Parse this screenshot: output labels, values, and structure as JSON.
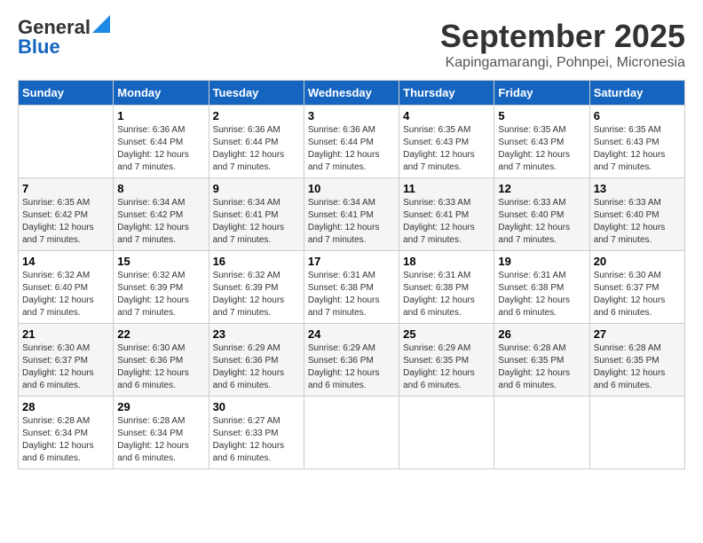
{
  "logo": {
    "general": "General",
    "blue": "Blue"
  },
  "title": "September 2025",
  "subtitle": "Kapingamarangi, Pohnpei, Micronesia",
  "days_of_week": [
    "Sunday",
    "Monday",
    "Tuesday",
    "Wednesday",
    "Thursday",
    "Friday",
    "Saturday"
  ],
  "weeks": [
    [
      {
        "day": "",
        "info": ""
      },
      {
        "day": "1",
        "info": "Sunrise: 6:36 AM\nSunset: 6:44 PM\nDaylight: 12 hours\nand 7 minutes."
      },
      {
        "day": "2",
        "info": "Sunrise: 6:36 AM\nSunset: 6:44 PM\nDaylight: 12 hours\nand 7 minutes."
      },
      {
        "day": "3",
        "info": "Sunrise: 6:36 AM\nSunset: 6:44 PM\nDaylight: 12 hours\nand 7 minutes."
      },
      {
        "day": "4",
        "info": "Sunrise: 6:35 AM\nSunset: 6:43 PM\nDaylight: 12 hours\nand 7 minutes."
      },
      {
        "day": "5",
        "info": "Sunrise: 6:35 AM\nSunset: 6:43 PM\nDaylight: 12 hours\nand 7 minutes."
      },
      {
        "day": "6",
        "info": "Sunrise: 6:35 AM\nSunset: 6:43 PM\nDaylight: 12 hours\nand 7 minutes."
      }
    ],
    [
      {
        "day": "7",
        "info": "Sunrise: 6:35 AM\nSunset: 6:42 PM\nDaylight: 12 hours\nand 7 minutes."
      },
      {
        "day": "8",
        "info": "Sunrise: 6:34 AM\nSunset: 6:42 PM\nDaylight: 12 hours\nand 7 minutes."
      },
      {
        "day": "9",
        "info": "Sunrise: 6:34 AM\nSunset: 6:41 PM\nDaylight: 12 hours\nand 7 minutes."
      },
      {
        "day": "10",
        "info": "Sunrise: 6:34 AM\nSunset: 6:41 PM\nDaylight: 12 hours\nand 7 minutes."
      },
      {
        "day": "11",
        "info": "Sunrise: 6:33 AM\nSunset: 6:41 PM\nDaylight: 12 hours\nand 7 minutes."
      },
      {
        "day": "12",
        "info": "Sunrise: 6:33 AM\nSunset: 6:40 PM\nDaylight: 12 hours\nand 7 minutes."
      },
      {
        "day": "13",
        "info": "Sunrise: 6:33 AM\nSunset: 6:40 PM\nDaylight: 12 hours\nand 7 minutes."
      }
    ],
    [
      {
        "day": "14",
        "info": "Sunrise: 6:32 AM\nSunset: 6:40 PM\nDaylight: 12 hours\nand 7 minutes."
      },
      {
        "day": "15",
        "info": "Sunrise: 6:32 AM\nSunset: 6:39 PM\nDaylight: 12 hours\nand 7 minutes."
      },
      {
        "day": "16",
        "info": "Sunrise: 6:32 AM\nSunset: 6:39 PM\nDaylight: 12 hours\nand 7 minutes."
      },
      {
        "day": "17",
        "info": "Sunrise: 6:31 AM\nSunset: 6:38 PM\nDaylight: 12 hours\nand 7 minutes."
      },
      {
        "day": "18",
        "info": "Sunrise: 6:31 AM\nSunset: 6:38 PM\nDaylight: 12 hours\nand 6 minutes."
      },
      {
        "day": "19",
        "info": "Sunrise: 6:31 AM\nSunset: 6:38 PM\nDaylight: 12 hours\nand 6 minutes."
      },
      {
        "day": "20",
        "info": "Sunrise: 6:30 AM\nSunset: 6:37 PM\nDaylight: 12 hours\nand 6 minutes."
      }
    ],
    [
      {
        "day": "21",
        "info": "Sunrise: 6:30 AM\nSunset: 6:37 PM\nDaylight: 12 hours\nand 6 minutes."
      },
      {
        "day": "22",
        "info": "Sunrise: 6:30 AM\nSunset: 6:36 PM\nDaylight: 12 hours\nand 6 minutes."
      },
      {
        "day": "23",
        "info": "Sunrise: 6:29 AM\nSunset: 6:36 PM\nDaylight: 12 hours\nand 6 minutes."
      },
      {
        "day": "24",
        "info": "Sunrise: 6:29 AM\nSunset: 6:36 PM\nDaylight: 12 hours\nand 6 minutes."
      },
      {
        "day": "25",
        "info": "Sunrise: 6:29 AM\nSunset: 6:35 PM\nDaylight: 12 hours\nand 6 minutes."
      },
      {
        "day": "26",
        "info": "Sunrise: 6:28 AM\nSunset: 6:35 PM\nDaylight: 12 hours\nand 6 minutes."
      },
      {
        "day": "27",
        "info": "Sunrise: 6:28 AM\nSunset: 6:35 PM\nDaylight: 12 hours\nand 6 minutes."
      }
    ],
    [
      {
        "day": "28",
        "info": "Sunrise: 6:28 AM\nSunset: 6:34 PM\nDaylight: 12 hours\nand 6 minutes."
      },
      {
        "day": "29",
        "info": "Sunrise: 6:28 AM\nSunset: 6:34 PM\nDaylight: 12 hours\nand 6 minutes."
      },
      {
        "day": "30",
        "info": "Sunrise: 6:27 AM\nSunset: 6:33 PM\nDaylight: 12 hours\nand 6 minutes."
      },
      {
        "day": "",
        "info": ""
      },
      {
        "day": "",
        "info": ""
      },
      {
        "day": "",
        "info": ""
      },
      {
        "day": "",
        "info": ""
      }
    ]
  ]
}
